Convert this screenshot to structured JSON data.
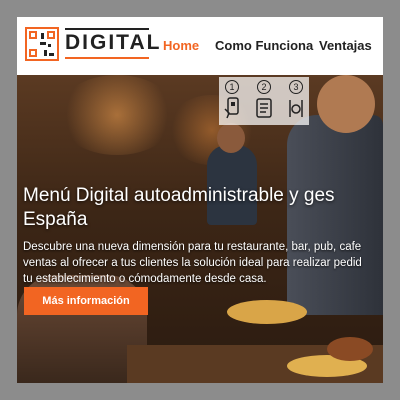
{
  "brand": {
    "name": "DIGITAL",
    "accent": "#f26522"
  },
  "nav": {
    "items": [
      "Home",
      "Como Funciona",
      "Ventajas"
    ],
    "active": "Home"
  },
  "steps": {
    "labels": [
      "1",
      "2",
      "3"
    ],
    "icons": [
      "scan-qr-icon",
      "menu-screen-icon",
      "dining-icon"
    ]
  },
  "hero": {
    "title_line1": "Menú Digital autoadministrable y ges",
    "title_line2": "España",
    "desc_line1": "Descubre una nueva dimensión para tu restaurante, bar, pub, cafe",
    "desc_line2": "ventas al ofrecer a tus clientes la solución ideal para realizar pedid",
    "desc_line3": "tu establecimiento o cómodamente desde casa.",
    "cta_label": "Más información"
  }
}
